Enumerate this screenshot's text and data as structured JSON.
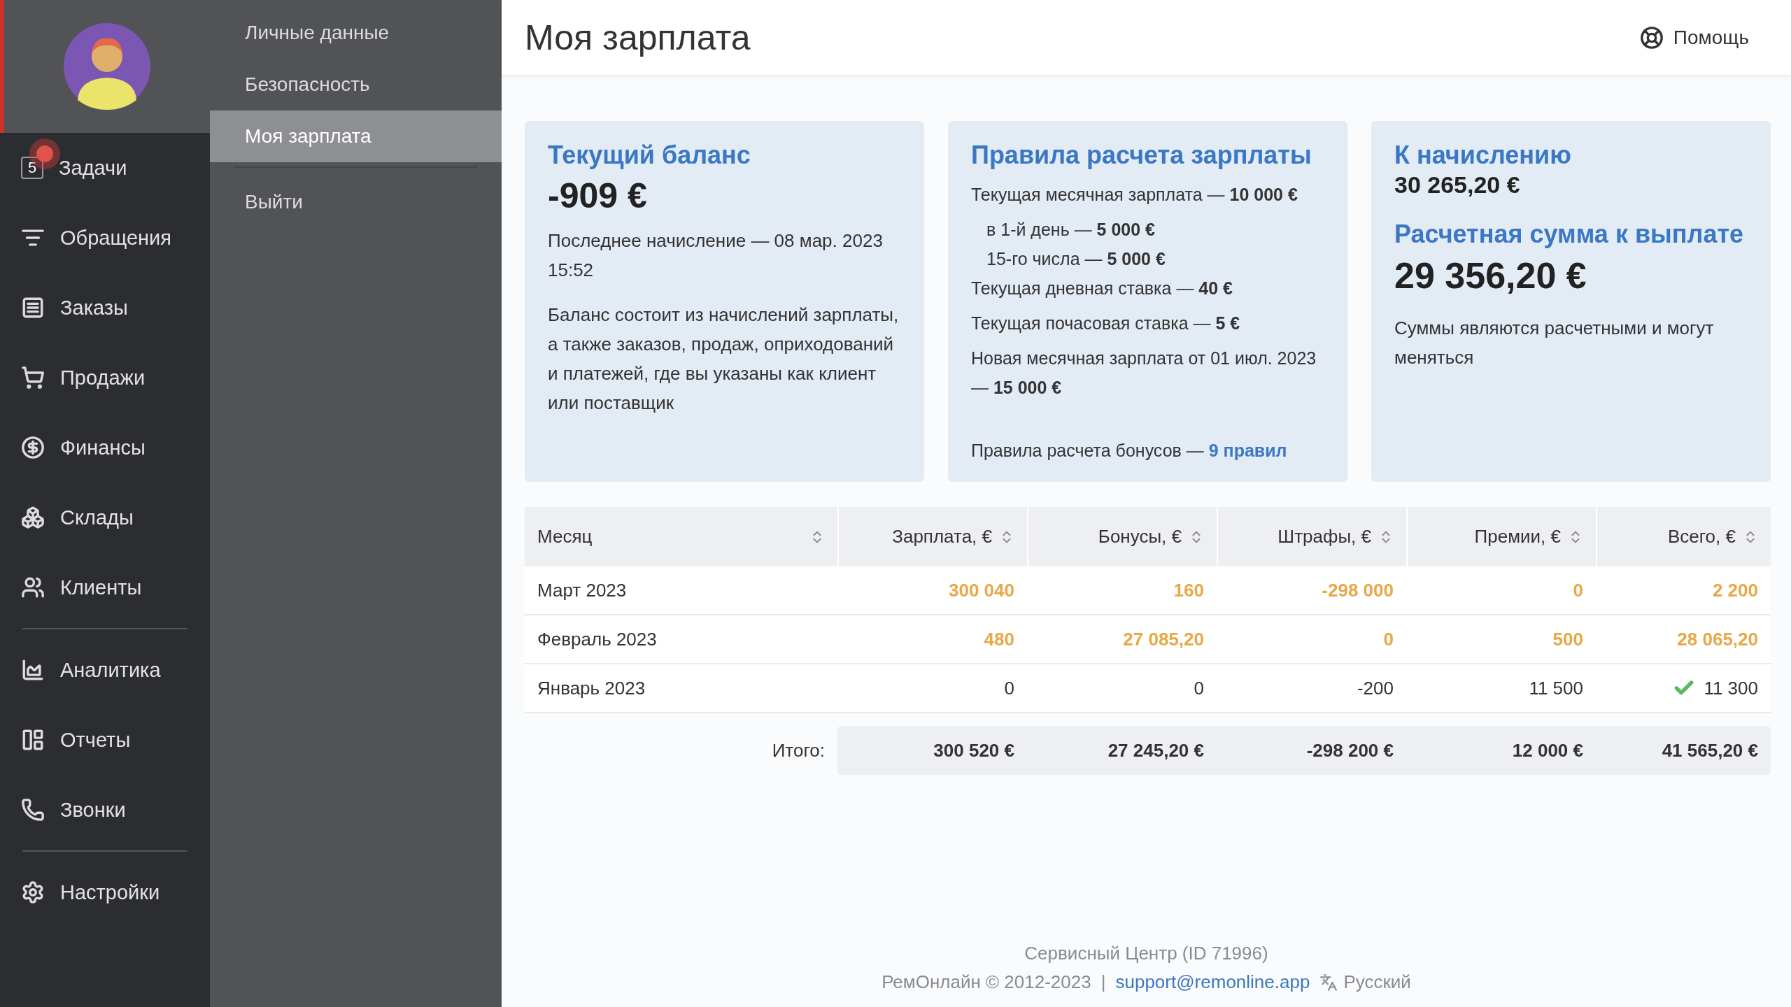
{
  "sidebar": {
    "groups": [
      [
        {
          "label": "Задачи",
          "badge": "5",
          "alert": true,
          "selected": false
        },
        {
          "label": "Обращения",
          "selected": false
        },
        {
          "label": "Заказы",
          "selected": false
        },
        {
          "label": "Продажи",
          "selected": false
        },
        {
          "label": "Финансы",
          "selected": false
        },
        {
          "label": "Склады",
          "selected": false
        },
        {
          "label": "Клиенты",
          "selected": false
        }
      ],
      [
        {
          "label": "Аналитика",
          "selected": false
        },
        {
          "label": "Отчеты",
          "selected": false
        },
        {
          "label": "Звонки",
          "selected": false
        }
      ],
      [
        {
          "label": "Настройки",
          "selected": false
        }
      ]
    ]
  },
  "submenu": {
    "items": [
      {
        "label": "Личные данные",
        "selected": false
      },
      {
        "label": "Безопасность",
        "selected": false
      },
      {
        "label": "Моя зарплата",
        "selected": true
      }
    ],
    "footer_items": [
      {
        "label": "Выйти",
        "selected": false
      }
    ]
  },
  "header": {
    "title": "Моя зарплата",
    "help": "Помощь"
  },
  "balance_card": {
    "title": "Текущий баланс",
    "amount": "-909 €",
    "last_charge": "Последнее начисление — 08 мар. 2023 15:52",
    "description": "Баланс состоит из начислений зарплаты, а также заказов, продаж, оприходований и платежей, где вы указаны как клиент или поставщик"
  },
  "rules_card": {
    "title": "Правила расчета зарплаты",
    "lines": [
      {
        "text": "Текущая месячная зарплата — **10 000 €**",
        "children": [
          {
            "text": "в 1-й день — **5 000 €**"
          },
          {
            "text": "15-го числа — **5 000 €**"
          }
        ]
      },
      {
        "text": "Текущая дневная ставка — **40 €**"
      },
      {
        "text": "Текущая почасовая ставка — **5 €**"
      },
      {
        "text": "Новая месячная зарплата от 01 июл. 2023 — **15 000 €**"
      }
    ],
    "bonus_label": "Правила расчета бонусов —",
    "bonus_link": "9 правил"
  },
  "accrual_card": {
    "title": "К начислению",
    "amount": "30 265,20 €",
    "payout_title": "Расчетная сумма к выплате",
    "payout_amount": "29 356,20 €",
    "note": "Суммы являются расчетными и могут меняться"
  },
  "table": {
    "columns": [
      {
        "label": "Месяц",
        "sortable": true
      },
      {
        "label": "Зарплата, €",
        "sortable": true
      },
      {
        "label": "Бонусы, €",
        "sortable": true
      },
      {
        "label": "Штрафы, €",
        "sortable": true
      },
      {
        "label": "Премии, €",
        "sortable": true
      },
      {
        "label": "Всего, €",
        "sortable": true
      }
    ],
    "rows": [
      {
        "cells": [
          "Март 2023",
          "300 040",
          "160",
          "-298 000",
          "0",
          "2 200"
        ],
        "pending": true,
        "paid": false
      },
      {
        "cells": [
          "Февраль 2023",
          "480",
          "27 085,20",
          "0",
          "500",
          "28 065,20"
        ],
        "pending": true,
        "paid": false
      },
      {
        "cells": [
          "Январь 2023",
          "0",
          "0",
          "-200",
          "11 500",
          "11 300"
        ],
        "pending": false,
        "paid": true
      }
    ],
    "totals": {
      "label": "Итого:",
      "values": [
        "300 520 €",
        "27 245,20 €",
        "-298 200 €",
        "12 000 €",
        "41 565,20 €"
      ]
    }
  },
  "footer": {
    "service_center": "Сервисный Центр (ID 71996)",
    "copyright": "РемОнлайн © 2012-2023",
    "separator": "|",
    "email": "support@remonline.app",
    "language": "Русский"
  }
}
